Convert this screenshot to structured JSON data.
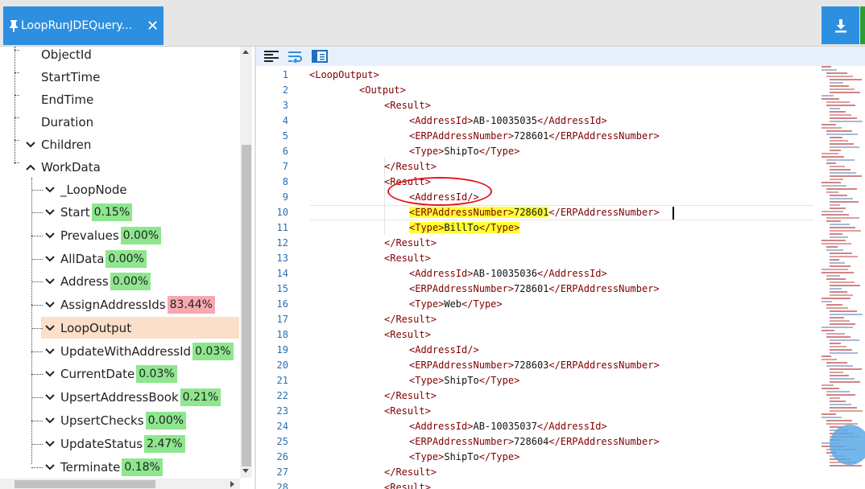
{
  "tab": {
    "title": "LoopRunJDEQuery...",
    "close_label": "✕",
    "pin_icon": "pin-icon"
  },
  "toolbar": {
    "download_icon": "download-icon",
    "accent": "#2d8fe0",
    "side_accent": "#2e9d36"
  },
  "tree": {
    "properties": [
      {
        "label": "ObjectId"
      },
      {
        "label": "StartTime"
      },
      {
        "label": "EndTime"
      },
      {
        "label": "Duration"
      }
    ],
    "children_label": "Children",
    "workdata_label": "WorkData",
    "nodes": [
      {
        "label": "_LoopNode",
        "badge": "",
        "badge_color": ""
      },
      {
        "label": "Start",
        "badge": "0.15%",
        "badge_color": "green"
      },
      {
        "label": "Prevalues",
        "badge": "0.00%",
        "badge_color": "green"
      },
      {
        "label": "AllData",
        "badge": "0.00%",
        "badge_color": "green"
      },
      {
        "label": "Address",
        "badge": "0.00%",
        "badge_color": "green"
      },
      {
        "label": "AssignAddressIds",
        "badge": "83.44%",
        "badge_color": "red"
      },
      {
        "label": "LoopOutput",
        "badge": "",
        "badge_color": "",
        "selected": true
      },
      {
        "label": "UpdateWithAddressId",
        "badge": "0.03%",
        "badge_color": "green"
      },
      {
        "label": "CurrentDate",
        "badge": "0.03%",
        "badge_color": "green"
      },
      {
        "label": "UpsertAddressBook",
        "badge": "0.21%",
        "badge_color": "green"
      },
      {
        "label": "UpsertChecks",
        "badge": "0.00%",
        "badge_color": "green"
      },
      {
        "label": "UpdateStatus",
        "badge": "2.47%",
        "badge_color": "green"
      },
      {
        "label": "Terminate",
        "badge": "0.18%",
        "badge_color": "green"
      }
    ]
  },
  "editor": {
    "toolbar_icons": [
      "align-left-icon",
      "word-wrap-icon",
      "panel-icon"
    ],
    "lines": [
      {
        "n": "1",
        "indent": 0,
        "parts": [
          [
            "tag",
            "<LoopOutput>"
          ]
        ]
      },
      {
        "n": "2",
        "indent": 1,
        "parts": [
          [
            "tag",
            "<Output>"
          ]
        ]
      },
      {
        "n": "3",
        "indent": 2,
        "parts": [
          [
            "tag",
            "<Result>"
          ]
        ]
      },
      {
        "n": "4",
        "indent": 3,
        "parts": [
          [
            "tag",
            "<AddressId>"
          ],
          [
            "txt",
            "AB-10035035"
          ],
          [
            "tag",
            "</AddressId>"
          ]
        ]
      },
      {
        "n": "5",
        "indent": 3,
        "parts": [
          [
            "tag",
            "<ERPAddressNumber>"
          ],
          [
            "txt",
            "728601"
          ],
          [
            "tag",
            "</ERPAddressNumber>"
          ]
        ]
      },
      {
        "n": "6",
        "indent": 3,
        "parts": [
          [
            "tag",
            "<Type>"
          ],
          [
            "txt",
            "ShipTo"
          ],
          [
            "tag",
            "</Type>"
          ]
        ]
      },
      {
        "n": "7",
        "indent": 2,
        "parts": [
          [
            "tag",
            "</Result>"
          ]
        ]
      },
      {
        "n": "8",
        "indent": 2,
        "parts": [
          [
            "tag",
            "<Result>"
          ]
        ]
      },
      {
        "n": "9",
        "indent": 3,
        "parts": [
          [
            "tag",
            "<AddressId/>"
          ]
        ]
      },
      {
        "n": "10",
        "indent": 3,
        "parts": [
          [
            "tag hl",
            "<ERPAddressNumber>"
          ],
          [
            "txt hl",
            "728601"
          ],
          [
            "tag",
            "</ERPAddressNumber>"
          ]
        ]
      },
      {
        "n": "11",
        "indent": 3,
        "parts": [
          [
            "tag hl",
            "<Type>"
          ],
          [
            "txt hl",
            "BillTo"
          ],
          [
            "tag hl",
            "</Type>"
          ]
        ]
      },
      {
        "n": "12",
        "indent": 2,
        "parts": [
          [
            "tag",
            "</Result>"
          ]
        ]
      },
      {
        "n": "13",
        "indent": 2,
        "parts": [
          [
            "tag",
            "<Result>"
          ]
        ]
      },
      {
        "n": "14",
        "indent": 3,
        "parts": [
          [
            "tag",
            "<AddressId>"
          ],
          [
            "txt",
            "AB-10035036"
          ],
          [
            "tag",
            "</AddressId>"
          ]
        ]
      },
      {
        "n": "15",
        "indent": 3,
        "parts": [
          [
            "tag",
            "<ERPAddressNumber>"
          ],
          [
            "txt",
            "728601"
          ],
          [
            "tag",
            "</ERPAddressNumber>"
          ]
        ]
      },
      {
        "n": "16",
        "indent": 3,
        "parts": [
          [
            "tag",
            "<Type>"
          ],
          [
            "txt",
            "Web"
          ],
          [
            "tag",
            "</Type>"
          ]
        ]
      },
      {
        "n": "17",
        "indent": 2,
        "parts": [
          [
            "tag",
            "</Result>"
          ]
        ]
      },
      {
        "n": "18",
        "indent": 2,
        "parts": [
          [
            "tag",
            "<Result>"
          ]
        ]
      },
      {
        "n": "19",
        "indent": 3,
        "parts": [
          [
            "tag",
            "<AddressId/>"
          ]
        ]
      },
      {
        "n": "20",
        "indent": 3,
        "parts": [
          [
            "tag",
            "<ERPAddressNumber>"
          ],
          [
            "txt",
            "728603"
          ],
          [
            "tag",
            "</ERPAddressNumber>"
          ]
        ]
      },
      {
        "n": "21",
        "indent": 3,
        "parts": [
          [
            "tag",
            "<Type>"
          ],
          [
            "txt",
            "ShipTo"
          ],
          [
            "tag",
            "</Type>"
          ]
        ]
      },
      {
        "n": "22",
        "indent": 2,
        "parts": [
          [
            "tag",
            "</Result>"
          ]
        ]
      },
      {
        "n": "23",
        "indent": 2,
        "parts": [
          [
            "tag",
            "<Result>"
          ]
        ]
      },
      {
        "n": "24",
        "indent": 3,
        "parts": [
          [
            "tag",
            "<AddressId>"
          ],
          [
            "txt",
            "AB-10035037"
          ],
          [
            "tag",
            "</AddressId>"
          ]
        ]
      },
      {
        "n": "25",
        "indent": 3,
        "parts": [
          [
            "tag",
            "<ERPAddressNumber>"
          ],
          [
            "txt",
            "728604"
          ],
          [
            "tag",
            "</ERPAddressNumber>"
          ]
        ]
      },
      {
        "n": "26",
        "indent": 3,
        "parts": [
          [
            "tag",
            "<Type>"
          ],
          [
            "txt",
            "ShipTo"
          ],
          [
            "tag",
            "</Type>"
          ]
        ]
      },
      {
        "n": "27",
        "indent": 2,
        "parts": [
          [
            "tag",
            "</Result>"
          ]
        ]
      },
      {
        "n": "28",
        "indent": 2,
        "parts": [
          [
            "tag",
            "<Result>"
          ]
        ]
      }
    ]
  },
  "chat_icon": "chat-bubble-icon"
}
